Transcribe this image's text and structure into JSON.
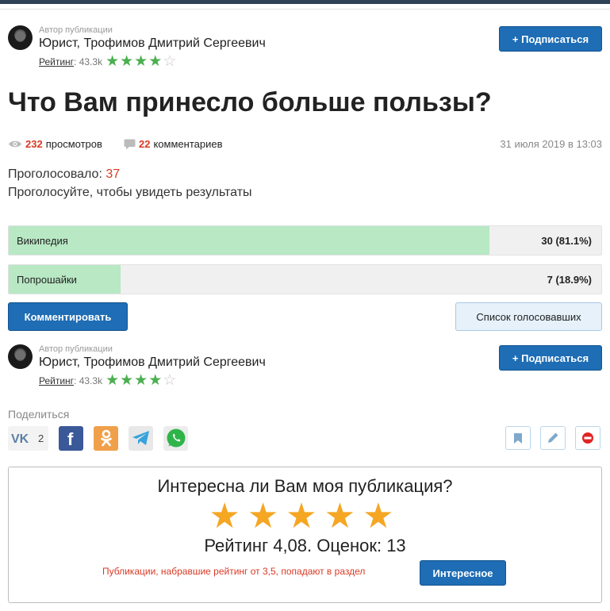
{
  "author": {
    "caption": "Автор публикации",
    "name": "Юрист, Трофимов Дмитрий Сергеевич",
    "rating_label": "Рейтинг",
    "rating_value": ": 43.3k",
    "stars_filled": 4,
    "stars_total": 5,
    "subscribe_label": "+ Подписаться"
  },
  "post": {
    "title": "Что Вам принесло больше пользы?",
    "views_count": "232",
    "views_label": "просмотров",
    "comments_count": "22",
    "comments_label": "комментариев",
    "date": "31 июля 2019 в 13:03"
  },
  "poll": {
    "voted_label": "Проголосовало: ",
    "voted_count": "37",
    "hint": "Проголосуйте, чтобы увидеть результаты",
    "options": [
      {
        "label": "Википедия",
        "result": "30 (81.1%)",
        "share": 0.811
      },
      {
        "label": "Попрошайки",
        "result": "7 (18.9%)",
        "share": 0.189
      }
    ],
    "comment_button": "Комментировать",
    "voters_button": "Список голосовавших"
  },
  "share": {
    "caption": "Поделиться",
    "vk_count": "2",
    "buttons": [
      "vk-icon",
      "facebook-icon",
      "odnoklassniki-icon",
      "telegram-icon",
      "whatsapp-icon"
    ]
  },
  "tools": [
    "bookmark-icon",
    "edit-icon",
    "report-icon"
  ],
  "rating_box": {
    "question": "Интересна ли Вам моя публикация?",
    "stars": 5,
    "score_text": "Рейтинг 4,08. Оценок: 13",
    "note": "Публикации, набравшие рейтинг от 3,5, попадают в раздел",
    "interesting_button": "Интересное"
  },
  "colors": {
    "accent": "#1e6db5",
    "highlight": "#d93a26",
    "star_green": "#4caf50",
    "star_orange": "#f5a623",
    "poll_fill": "#b8e8c4"
  }
}
